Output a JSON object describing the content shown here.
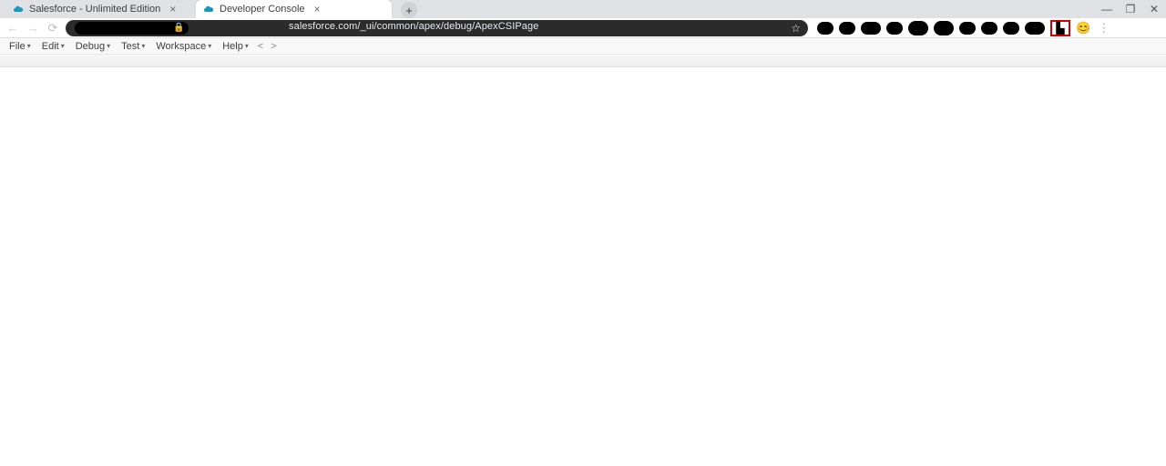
{
  "window": {
    "controls": {
      "minimize": "—",
      "maximize": "▢",
      "close": "✕"
    }
  },
  "tabs": [
    {
      "title": "Salesforce - Unlimited Edition",
      "active": false
    },
    {
      "title": "Developer Console",
      "active": true
    }
  ],
  "newtab_label": "+",
  "omnibox": {
    "url_visible": "salesforce.com/_ui/common/apex/debug/ApexCSIPage"
  },
  "extensions": {
    "highlighted_glyph": "⬤"
  },
  "menubar": {
    "items": [
      {
        "label": "File"
      },
      {
        "label": "Edit"
      },
      {
        "label": "Debug"
      },
      {
        "label": "Test"
      },
      {
        "label": "Workspace"
      },
      {
        "label": "Help"
      }
    ],
    "nav_prev": "<",
    "nav_next": ">"
  }
}
